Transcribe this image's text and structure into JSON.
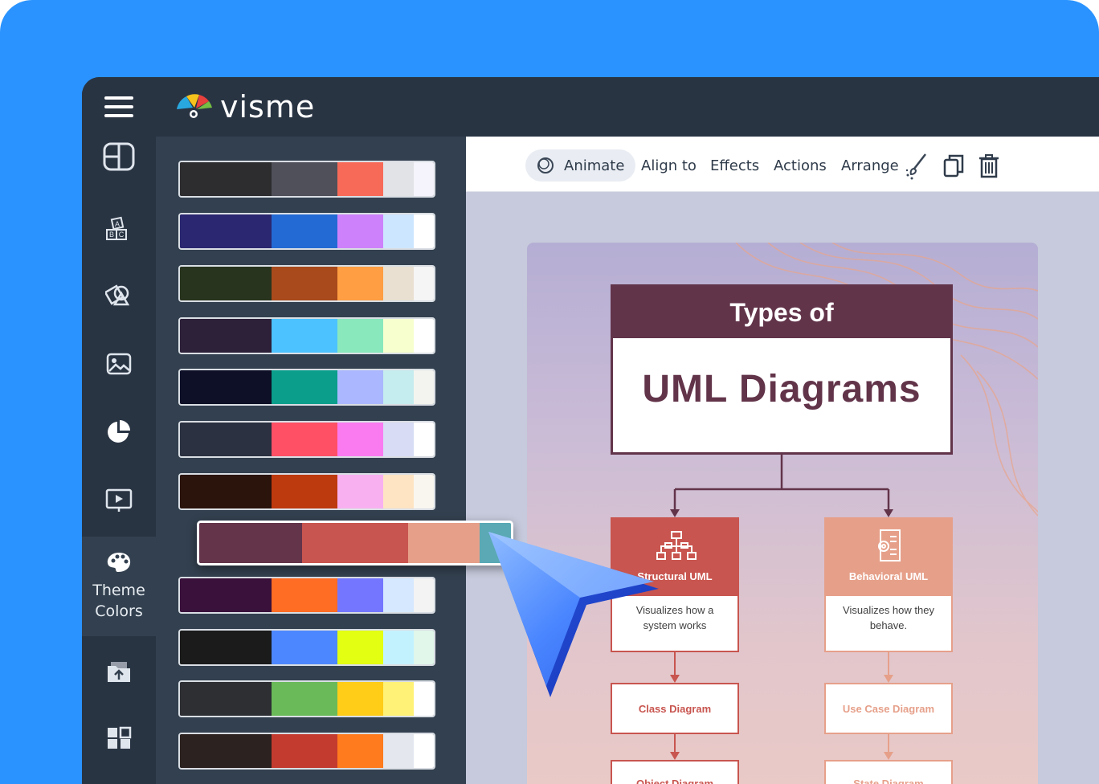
{
  "app": {
    "name": "visme"
  },
  "sidebar": {
    "items": [
      {
        "icon": "layout-icon"
      },
      {
        "icon": "text-blocks-icon"
      },
      {
        "icon": "shapes-icon"
      },
      {
        "icon": "image-icon"
      },
      {
        "icon": "chart-icon"
      },
      {
        "icon": "media-icon"
      },
      {
        "icon": "palette-icon",
        "label_line1": "Theme",
        "label_line2": "Colors",
        "active": true
      },
      {
        "icon": "upload-icon"
      },
      {
        "icon": "apps-icon"
      }
    ]
  },
  "palettes": [
    [
      "#2d2d30",
      "#4f5059",
      "#f86a58",
      "#e1e3e7",
      "#f5f4fc"
    ],
    [
      "#2b2770",
      "#246ad4",
      "#cd82fb",
      "#cde6ff",
      "#ffffff"
    ],
    [
      "#29341e",
      "#a84a1c",
      "#ff9e42",
      "#e9e0d1",
      "#f5f5f5"
    ],
    [
      "#2d2039",
      "#4cc2ff",
      "#8ae8bd",
      "#f7ffcf",
      "#ffffff"
    ],
    [
      "#0d1027",
      "#0a9e8b",
      "#abb8ff",
      "#c5ecef",
      "#f3f4ef"
    ],
    [
      "#2b3140",
      "#ff5066",
      "#fa7bf0",
      "#d8dcf5",
      "#ffffff"
    ],
    [
      "#2b140c",
      "#bd390e",
      "#f8b0f0",
      "#ffe4c4",
      "#f8f6ef"
    ],
    [
      "#3a113b",
      "#ff6c24",
      "#7476ff",
      "#d5e8ff",
      "#f3f3f3"
    ],
    [
      "#1b1b1b",
      "#4d87ff",
      "#e3ff12",
      "#c3f2ff",
      "#e0f7ea"
    ],
    [
      "#2d2f33",
      "#6aba5a",
      "#ffcc18",
      "#fff277",
      "#ffffff"
    ],
    [
      "#2c221f",
      "#c33b2f",
      "#ff7b1e",
      "#e4e7ee",
      "#ffffff"
    ]
  ],
  "selected_palette": [
    "#63344a",
    "#c8554f",
    "#e6a08a",
    "#5aa9b5"
  ],
  "toolbar": {
    "animate": "Animate",
    "align_to": "Align to",
    "effects": "Effects",
    "actions": "Actions",
    "arrange": "Arrange"
  },
  "document": {
    "title_top": "Types of",
    "title_main": "UML Diagrams",
    "left_card": {
      "title": "Structural UML",
      "desc": "Visualizes how a system works"
    },
    "right_card": {
      "title": "Behavioral UML",
      "desc": "Visualizes how they behave."
    },
    "left_box": "Class Diagram",
    "right_box": "Use Case Diagram",
    "left_box2": "Object Diagram",
    "right_box2": "State Diagram",
    "colors": {
      "maroon": "#62344a",
      "red": "#c8554f",
      "peach": "#e6a08a"
    }
  }
}
